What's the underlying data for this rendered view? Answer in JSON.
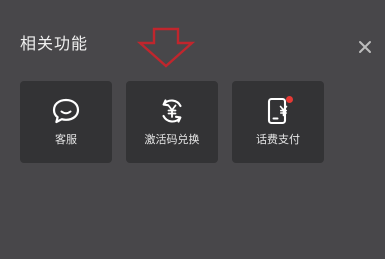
{
  "panel": {
    "title": "相关功能",
    "close_icon": "close-icon",
    "annotation_icon": "down-arrow-outline-icon"
  },
  "tiles": [
    {
      "label": "客服",
      "icon": "chat-bubble-icon"
    },
    {
      "label": "激活码兑换",
      "icon": "yen-exchange-icon"
    },
    {
      "label": "话费支付",
      "icon": "phone-yen-icon",
      "badge": "red-dot"
    }
  ],
  "colors": {
    "background": "#48474a",
    "tile": "#333335",
    "text": "#e6e6e6",
    "annotation": "#c0262d",
    "badge": "#e53935"
  }
}
